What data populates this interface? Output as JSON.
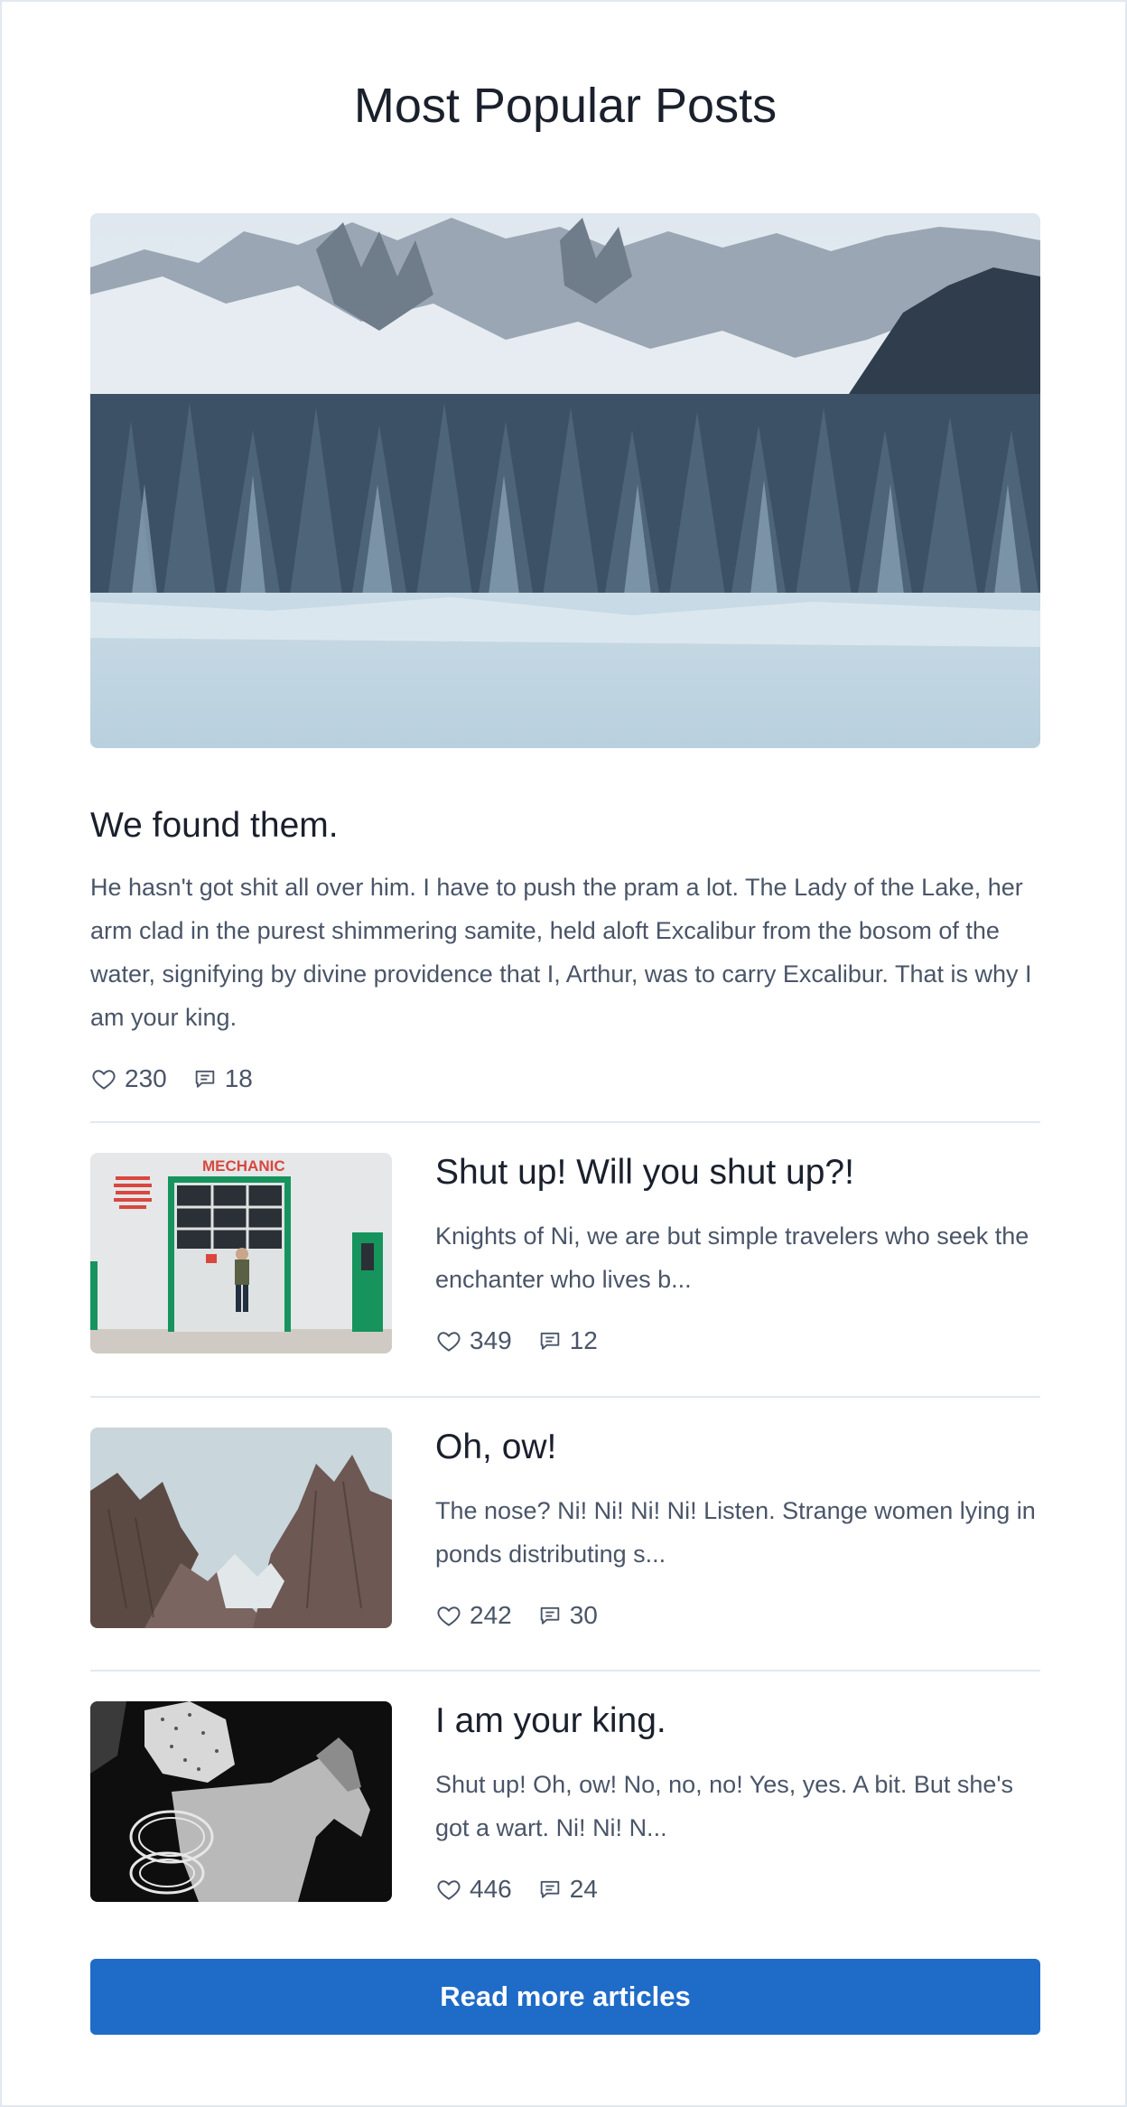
{
  "page": {
    "title": "Most Popular Posts"
  },
  "featured": {
    "image": "snowy-mountain-forest-image",
    "title": "We found them.",
    "excerpt": "He hasn't got shit all over him. I have to push the pram a lot. The Lady of the Lake, her arm clad in the purest shimmering samite, held aloft Excalibur from the bosom of the water, signifying by divine providence that I, Arthur, was to carry Excalibur. That is why I am your king.",
    "likes": "230",
    "comments": "18"
  },
  "posts": [
    {
      "image": "mechanic-garage-image",
      "title": "Shut up! Will you shut up?!",
      "excerpt": "Knights of Ni, we are but simple travelers who seek the enchanter who lives b...",
      "likes": "349",
      "comments": "12"
    },
    {
      "image": "rocky-peaks-image",
      "title": "Oh, ow!",
      "excerpt": "The nose? Ni! Ni! Ni! Ni! Listen. Strange women lying in ponds distributing s...",
      "likes": "242",
      "comments": "30"
    },
    {
      "image": "cowboy-horse-bw-image",
      "title": "I am your king.",
      "excerpt": "Shut up! Oh, ow! No, no, no! Yes, yes. A bit. But she's got a wart. Ni! Ni! N...",
      "likes": "446",
      "comments": "24"
    }
  ],
  "image_text": {
    "garage_sign": "MECHANIC"
  },
  "cta": {
    "label": "Read more articles"
  },
  "colors": {
    "accent": "#1f6bc8",
    "text": "#1a202c",
    "muted": "#4a5568",
    "divider": "#e2e8f0"
  },
  "icons": {
    "like": "heart-icon",
    "comment": "comment-icon"
  }
}
